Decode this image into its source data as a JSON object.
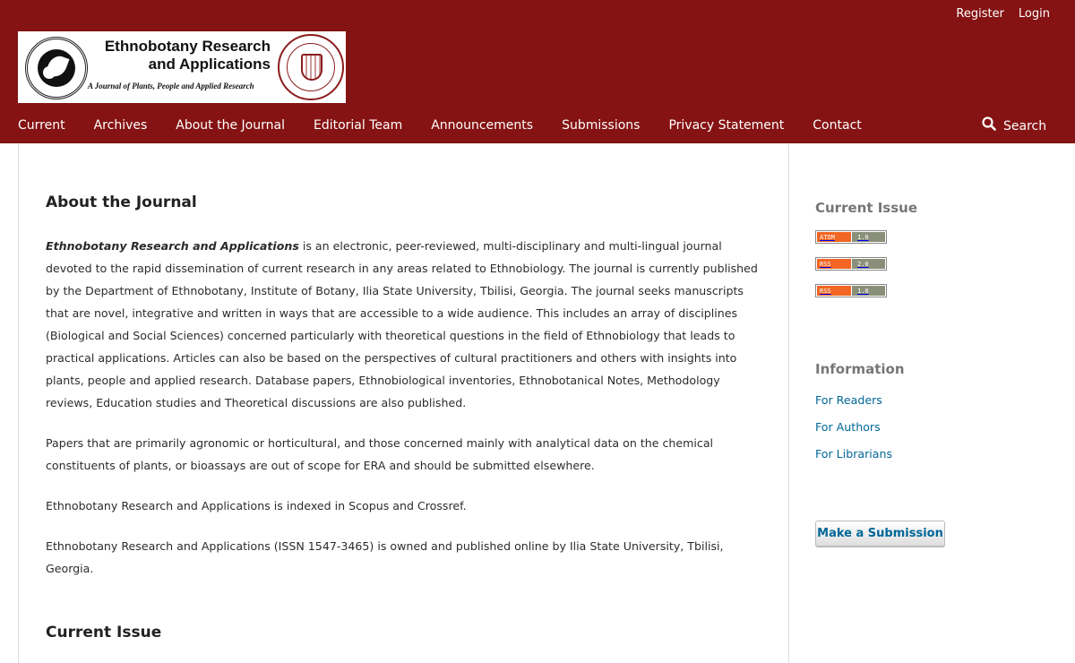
{
  "user_nav": {
    "register": "Register",
    "login": "Login"
  },
  "logo": {
    "title_line1": "Ethnobotany Research",
    "title_line2": "and Applications",
    "subtitle": "A Journal of Plants, People and Applied Research"
  },
  "primary_nav": [
    {
      "label": "Current"
    },
    {
      "label": "Archives"
    },
    {
      "label": "About the Journal"
    },
    {
      "label": "Editorial Team"
    },
    {
      "label": "Announcements"
    },
    {
      "label": "Submissions"
    },
    {
      "label": "Privacy Statement"
    },
    {
      "label": "Contact"
    }
  ],
  "search": {
    "label": "Search",
    "icon": "search-icon"
  },
  "main": {
    "title": "About the Journal",
    "intro_emphasis": "Ethnobotany Research and Applications",
    "intro_rest": " is an electronic, peer-reviewed, multi-disciplinary and multi-lingual journal devoted to the rapid dissemination of current research in any areas related to Ethnobiology. The journal is currently published by the Department of Ethnobotany, Institute of Botany, Ilia State University, Tbilisi, Georgia. The journal seeks manuscripts that are novel, integrative and written in ways that are accessible to a wide audience. This includes an array of disciplines (Biological and Social Sciences) concerned particularly with theoretical questions in the field of Ethnobiology that leads to practical applications. Articles can also be based on the perspectives of cultural practitioners and others with insights into plants, people and applied research. Database papers, Ethnobiological inventories, Ethnobotanical Notes, Methodology reviews, Education studies and Theoretical discussions are also published.",
    "para2": "Papers that are primarily agronomic or horticultural, and those concerned mainly with analytical data on the chemical constituents of plants, or bioassays are out of scope for ERA and should be submitted elsewhere.",
    "para3": "Ethnobotany Research and Applications is indexed in Scopus and Crossref.",
    "para4": "Ethnobotany Research and Applications (ISSN 1547-3465) is owned and published online by Ilia State University, Tbilisi, Georgia.",
    "current_issue_heading": "Current Issue"
  },
  "sidebar": {
    "current_issue_heading": "Current Issue",
    "feeds": [
      {
        "left": "ATOM",
        "right": "1.0"
      },
      {
        "left": "RSS",
        "right": "2.0"
      },
      {
        "left": "RSS",
        "right": "1.0"
      }
    ],
    "information_heading": "Information",
    "info_links": [
      {
        "label": "For Readers"
      },
      {
        "label": "For Authors"
      },
      {
        "label": "For Librarians"
      }
    ],
    "submit_button": "Make a Submission"
  },
  "colors": {
    "header_bg": "#851313",
    "link": "#006798",
    "feed_left": "#f26522",
    "feed_right": "#8a8f7a"
  }
}
